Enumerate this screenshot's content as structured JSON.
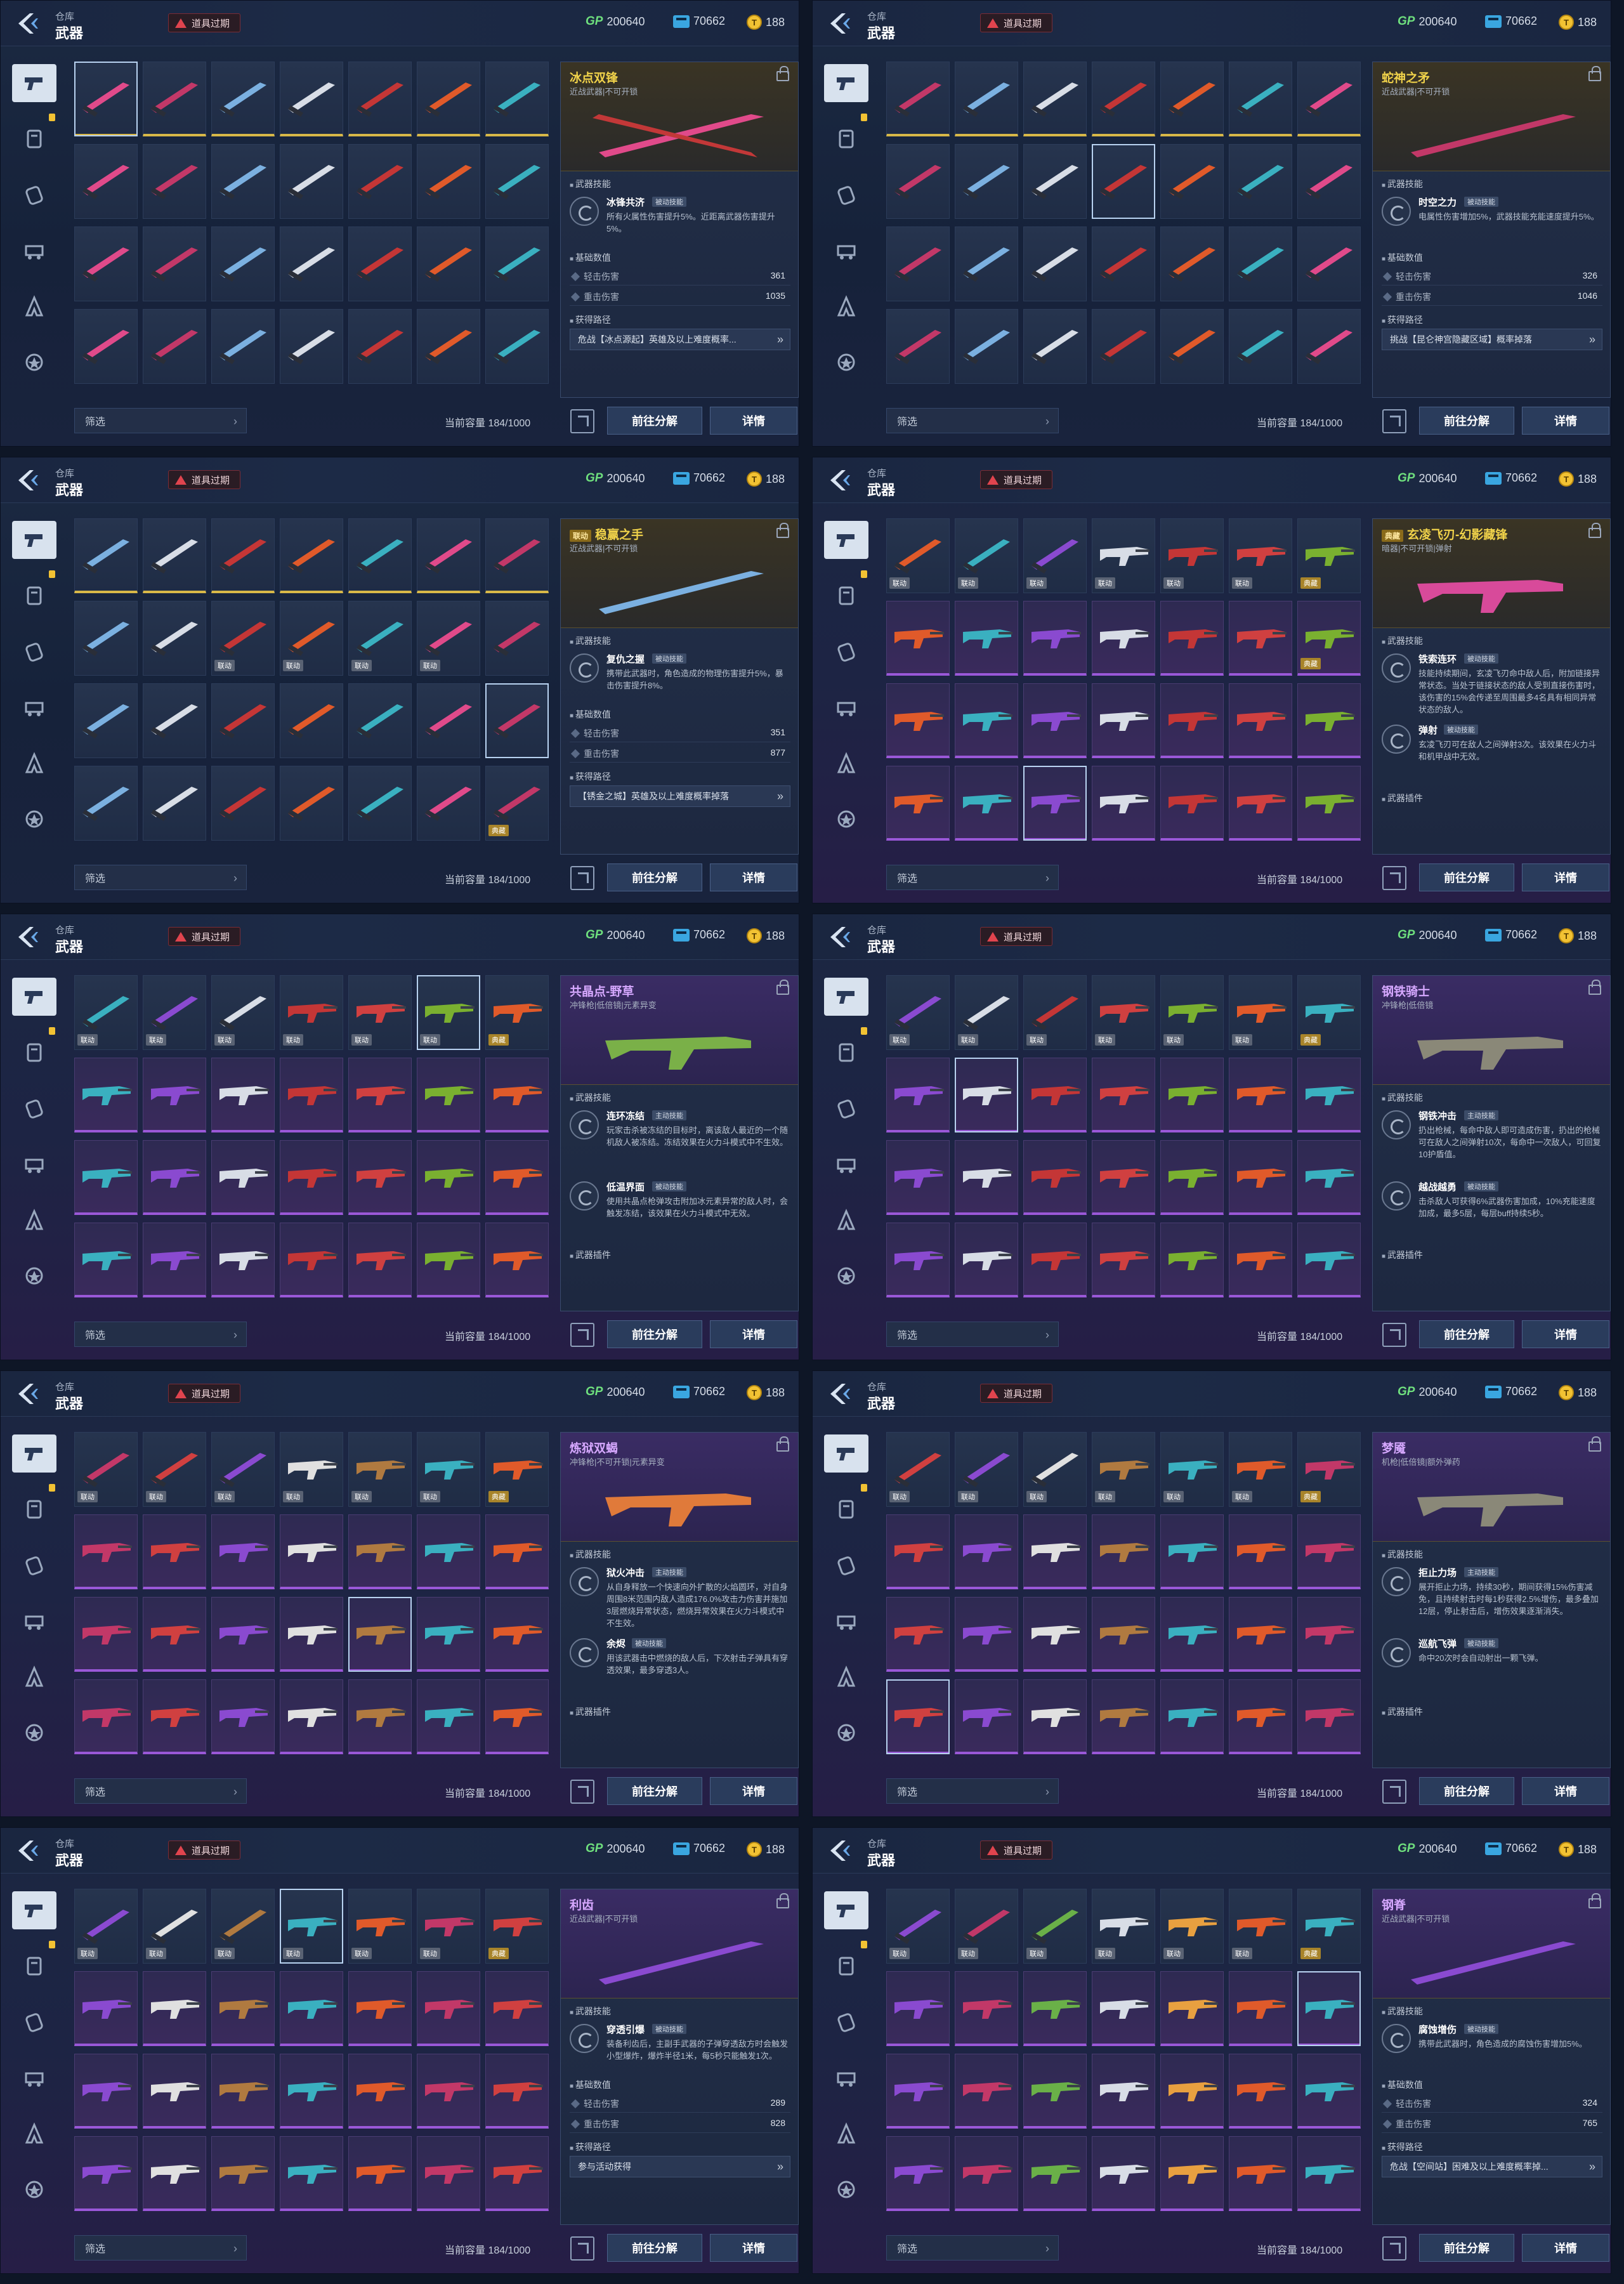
{
  "header": {
    "breadcrumb": "仓库",
    "title": "武器",
    "expired_label": "道具过期",
    "gp_label": "GP",
    "gp_value": "200640",
    "ticket_value": "70662",
    "coin_value": "188"
  },
  "footer": {
    "filter_label": "筛选",
    "capacity_label": "当前容量 184/1000",
    "dismantle_label": "前往分解",
    "detail_label": "详情"
  },
  "cell_tags": {
    "linked": "联动",
    "classic": "典藏"
  },
  "sections": {
    "skills": "武器技能",
    "stats": "基础数值",
    "source": "获得路径",
    "plugins": "武器插件"
  },
  "stat_labels": {
    "light": "轻击伤害",
    "heavy": "重击伤害"
  },
  "skill_types": {
    "active": "主动技能",
    "passive": "被动技能"
  },
  "panels": [
    {
      "name": "冰点双锋",
      "subtitle": "近战武器|不可开锁",
      "skill1_name": "冰锋共济",
      "skill1_type": "被动技能",
      "skill1_desc": "所有火属性伤害提升5%。近距离武器伤害提升5%。",
      "stat_light": "361",
      "stat_heavy": "1035",
      "source": "危战【冰点源起】英雄及以上难度概率..."
    },
    {
      "name": "蛇神之矛",
      "subtitle": "近战武器|不可开锁",
      "skill1_name": "时空之力",
      "skill1_type": "被动技能",
      "skill1_desc": "电属性伤害增加5%，武器技能充能速度提升5%。",
      "stat_light": "326",
      "stat_heavy": "1046",
      "source": "挑战【昆仑神宫隐藏区域】概率掉落"
    },
    {
      "name": "稳赢之手",
      "name_tag": "联动",
      "subtitle": "近战武器|不可开锁",
      "skill1_name": "复仇之握",
      "skill1_type": "被动技能",
      "skill1_desc": "携带此武器时，角色造成的物理伤害提升5%，暴击伤害提升8%。",
      "stat_light": "351",
      "stat_heavy": "877",
      "source": "【锈金之城】英雄及以上难度概率掉落"
    },
    {
      "name": "玄凌飞刃-幻影藏锋",
      "name_tag": "典藏",
      "subtitle": "暗器|不可开锁|弹射",
      "skill1_name": "铁索连环",
      "skill1_type": "被动技能",
      "skill1_desc": "技能持续期间，玄凌飞刃命中敌人后，附加链接异常状态。当处于链接状态的敌人受到直接伤害时，该伤害的15%会传递至周围最多4名具有相同异常状态的敌人。",
      "skill2_name": "弹射",
      "skill2_type": "被动技能",
      "skill2_desc": "玄凌飞刃可在敌人之间弹射3次。该效果在火力斗和机甲战中无效。",
      "source_label": "武器插件"
    },
    {
      "name": "共晶点-野草",
      "subtitle": "冲锋枪|低倍镜|元素异变",
      "skill1_name": "连环冻结",
      "skill1_type": "主动技能",
      "skill1_desc": "玩家击杀被冻结的目标时，离该敌人最近的一个随机敌人被冻结。冻结效果在火力斗模式中不生效。",
      "skill2_name": "低温界面",
      "skill2_type": "被动技能",
      "skill2_desc": "使用共晶点枪弹攻击附加冰元素异常的敌人时，会触发冻结，该效果在火力斗模式中无效。"
    },
    {
      "name": "钢铁骑士",
      "subtitle": "冲锋枪|低倍镜",
      "skill1_name": "钢铁冲击",
      "skill1_type": "主动技能",
      "skill1_desc": "扔出枪械，每命中敌人即可造成伤害，扔出的枪械可在敌人之间弹射10次，每命中一次敌人，可回复10护盾值。",
      "skill2_name": "越战越勇",
      "skill2_type": "被动技能",
      "skill2_desc": "击杀敌人可获得6%武器伤害加成，10%充能速度加成，最多5层，每层buff持续5秒。"
    },
    {
      "name": "炼狱双蝎",
      "subtitle": "冲锋枪|不可开锁|元素异变",
      "skill1_name": "狱火冲击",
      "skill1_type": "主动技能",
      "skill1_desc": "从自身释放一个快速向外扩散的火焰圆环，对自身周围8米范围内敌人造成176.0%攻击力伤害并施加3层燃烧异常状态，燃烧异常效果在火力斗模式中不生效。",
      "skill2_name": "余烬",
      "skill2_type": "被动技能",
      "skill2_desc": "用该武器击中燃烧的敌人后，下次射击子弹具有穿透效果，最多穿透3人。"
    },
    {
      "name": "梦魇",
      "subtitle": "机枪|低倍镜|额外弹药",
      "skill1_name": "拒止力场",
      "skill1_type": "主动技能",
      "skill1_desc": "展开拒止力场，持续30秒，期间获得15%伤害减免，且持续射击时每1秒获得2.5%增伤，最多叠加12层，停止射击后，增伤效果逐渐消失。",
      "skill2_name": "巡航飞弹",
      "skill2_type": "被动技能",
      "skill2_desc": "命中20次时会自动射出一颗飞弹。"
    },
    {
      "name": "利齿",
      "subtitle": "近战武器|不可开锁",
      "skill1_name": "穿透引爆",
      "skill1_type": "被动技能",
      "skill1_desc": "装备利齿后，主副手武器的子弹穿透敌方时会触发小型爆炸，爆炸半径1米，每5秒只能触发1次。",
      "stat_light": "289",
      "stat_heavy": "828",
      "source": "参与活动获得"
    },
    {
      "name": "钢脊",
      "subtitle": "近战武器|不可开锁",
      "skill1_name": "腐蚀增伤",
      "skill1_type": "被动技能",
      "skill1_desc": "携带此武器时，角色造成的腐蚀伤害增加5%。",
      "stat_light": "324",
      "stat_heavy": "765",
      "source": "危战【空间站】困难及以上难度概率掉..."
    }
  ]
}
